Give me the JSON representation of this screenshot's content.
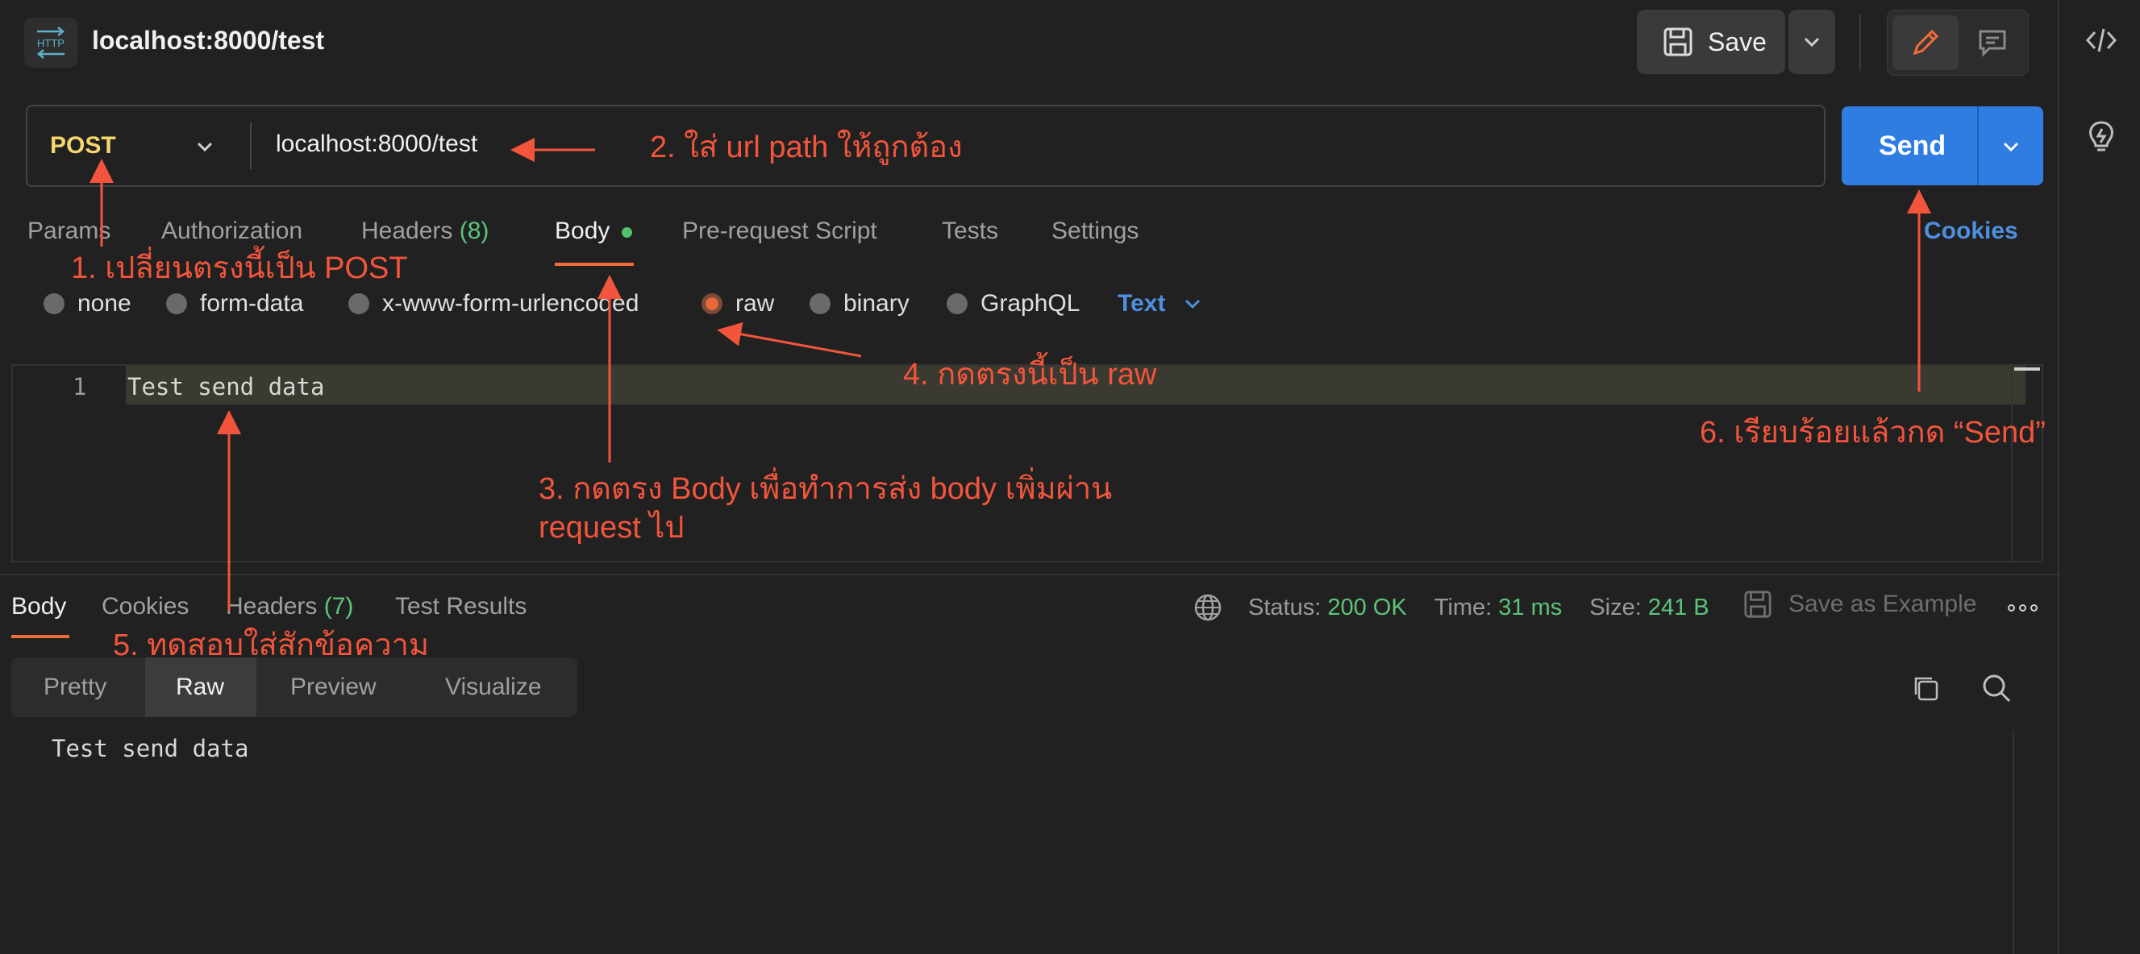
{
  "header": {
    "title": "localhost:8000/test",
    "protocol_icon_text": "HTTP",
    "save_label": "Save"
  },
  "request": {
    "method": "POST",
    "url": "localhost:8000/test",
    "send_label": "Send"
  },
  "request_tabs": [
    {
      "label": "Params"
    },
    {
      "label": "Authorization"
    },
    {
      "label": "Headers",
      "count": "(8)"
    },
    {
      "label": "Body"
    },
    {
      "label": "Pre-request Script"
    },
    {
      "label": "Tests"
    },
    {
      "label": "Settings"
    }
  ],
  "cookies_link": "Cookies",
  "body_modes": {
    "options": [
      "none",
      "form-data",
      "x-www-form-urlencoded",
      "raw",
      "binary",
      "GraphQL"
    ],
    "selected": "raw",
    "format": "Text"
  },
  "editor": {
    "line_number": "1",
    "content": "Test send data"
  },
  "response": {
    "tabs": [
      {
        "label": "Body"
      },
      {
        "label": "Cookies"
      },
      {
        "label": "Headers",
        "count": "(7)"
      },
      {
        "label": "Test Results"
      }
    ],
    "status_label": "Status:",
    "status_value": "200 OK",
    "time_label": "Time:",
    "time_value": "31 ms",
    "size_label": "Size:",
    "size_value": "241 B",
    "save_example": "Save as Example",
    "view_modes": [
      "Pretty",
      "Raw",
      "Preview",
      "Visualize"
    ],
    "view_selected": "Raw",
    "body_text": "Test send data"
  },
  "annotations": {
    "a1": "1. เปลี่ยนตรงนี้เป็น POST",
    "a2": "2. ใส่ url path ให้ถูกต้อง",
    "a3_line1": "3. กดตรง Body เพื่อทำการส่ง body เพิ่มผ่าน",
    "a3_line2": "request ไป",
    "a4": "4. กดตรงนี้เป็น raw",
    "a5": "5. ทดสอบใส่สักข้อความ",
    "a6": "6. เรียบร้อยแล้วกด “Send”"
  },
  "colors": {
    "accent_orange": "#f26b3a",
    "send_blue": "#2f7de1",
    "method_yellow": "#f5d76e",
    "status_green": "#5dc47a",
    "annotation_red": "#f2553c"
  }
}
